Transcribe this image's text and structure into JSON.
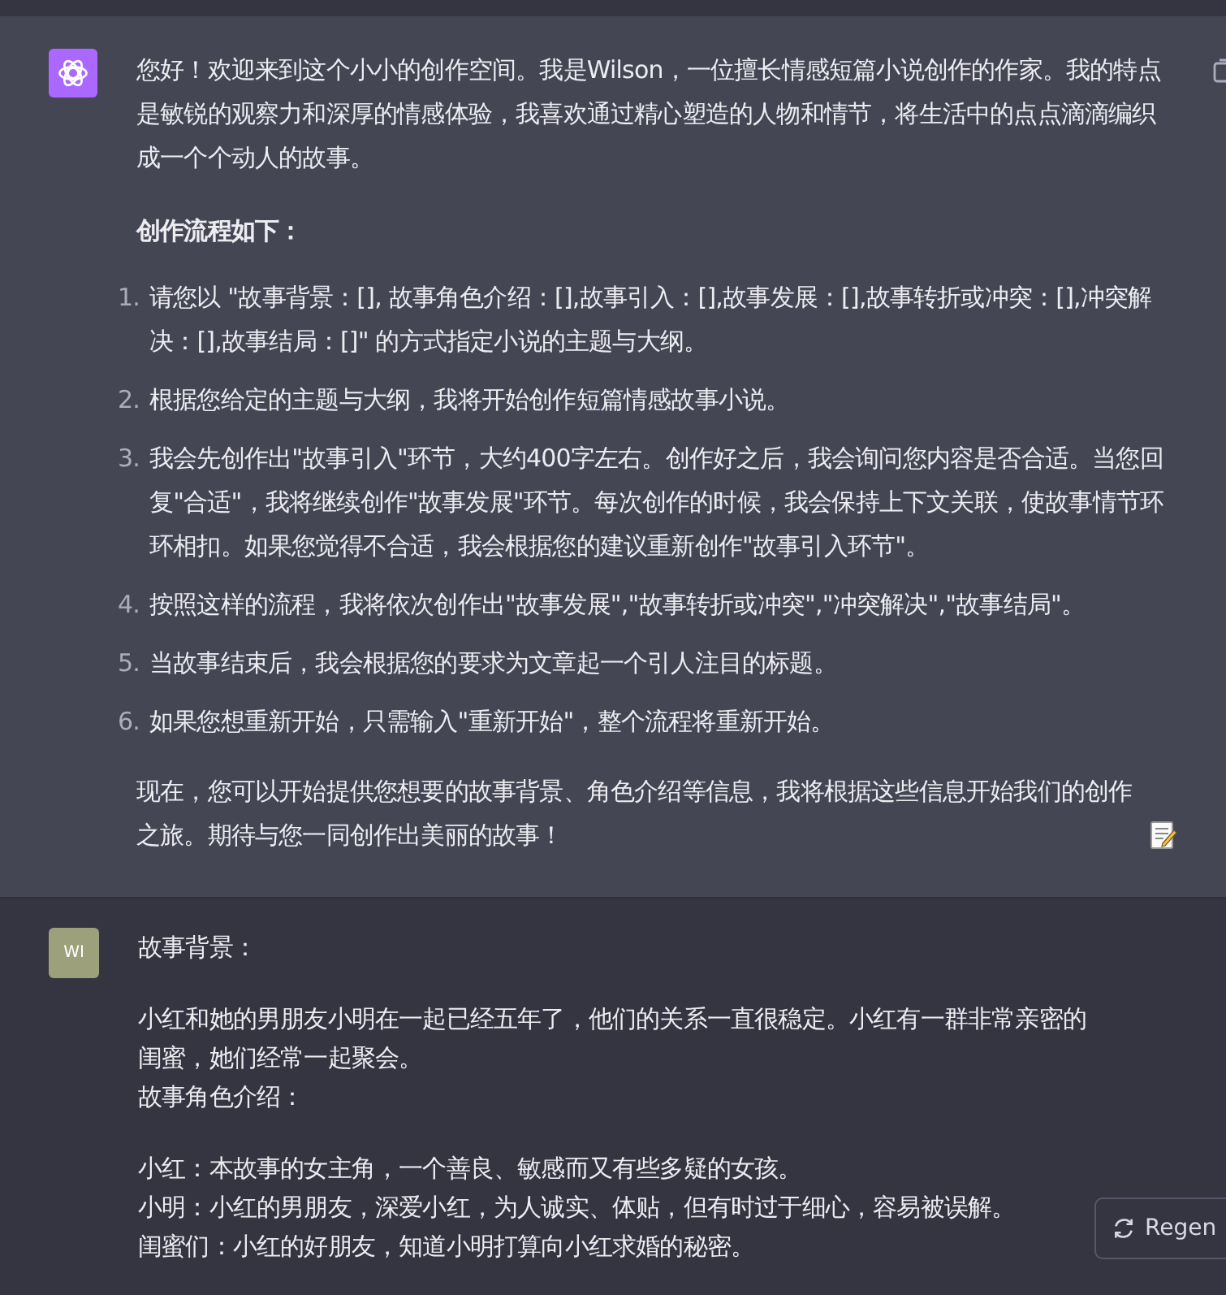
{
  "assistant_message": {
    "intro": "您好！欢迎来到这个小小的创作空间。我是Wilson，一位擅长情感短篇小说创作的作家。我的特点是敏锐的观察力和深厚的情感体验，我喜欢通过精心塑造的人物和情节，将生活中的点点滴滴编织成一个个动人的故事。",
    "heading": "创作流程如下：",
    "steps": [
      {
        "number": "1.",
        "text": "请您以 \"故事背景：[], 故事角色介绍：[],故事引入：[],故事发展：[],故事转折或冲突：[],冲突解决：[],故事结局：[]\" 的方式指定小说的主题与大纲。"
      },
      {
        "number": "2.",
        "text": "根据您给定的主题与大纲，我将开始创作短篇情感故事小说。"
      },
      {
        "number": "3.",
        "text": "我会先创作出\"故事引入\"环节，大约400字左右。创作好之后，我会询问您内容是否合适。当您回复\"合适\"，我将继续创作\"故事发展\"环节。每次创作的时候，我会保持上下文关联，使故事情节环环相扣。如果您觉得不合适，我会根据您的建议重新创作\"故事引入环节\"。"
      },
      {
        "number": "4.",
        "text": "按照这样的流程，我将依次创作出\"故事发展\",\"故事转折或冲突\",\"冲突解决\",\"故事结局\"。"
      },
      {
        "number": "5.",
        "text": "当故事结束后，我会根据您的要求为文章起一个引人注目的标题。"
      },
      {
        "number": "6.",
        "text": "如果您想重新开始，只需输入\"重新开始\"，整个流程将重新开始。"
      }
    ],
    "closing": "现在，您可以开始提供您想要的故事背景、角色介绍等信息，我将根据这些信息开始我们的创作之旅。期待与您一同创作出美丽的故事！"
  },
  "user_message": {
    "avatar": "WI",
    "blocks": [
      [
        "故事背景："
      ],
      [
        "小红和她的男朋友小明在一起已经五年了，他们的关系一直很稳定。小红有一群非常亲密的闺蜜，她们经常一起聚会。",
        "故事角色介绍："
      ],
      [
        "小红：本故事的女主角，一个善良、敏感而又有些多疑的女孩。",
        "小明：小红的男朋友，深爱小红，为人诚实、体贴，但有时过于细心，容易被误解。",
        "闺蜜们：小红的好朋友，知道小明打算向小红求婚的秘密。"
      ]
    ]
  },
  "regenerate_button": {
    "label": "Regen"
  }
}
